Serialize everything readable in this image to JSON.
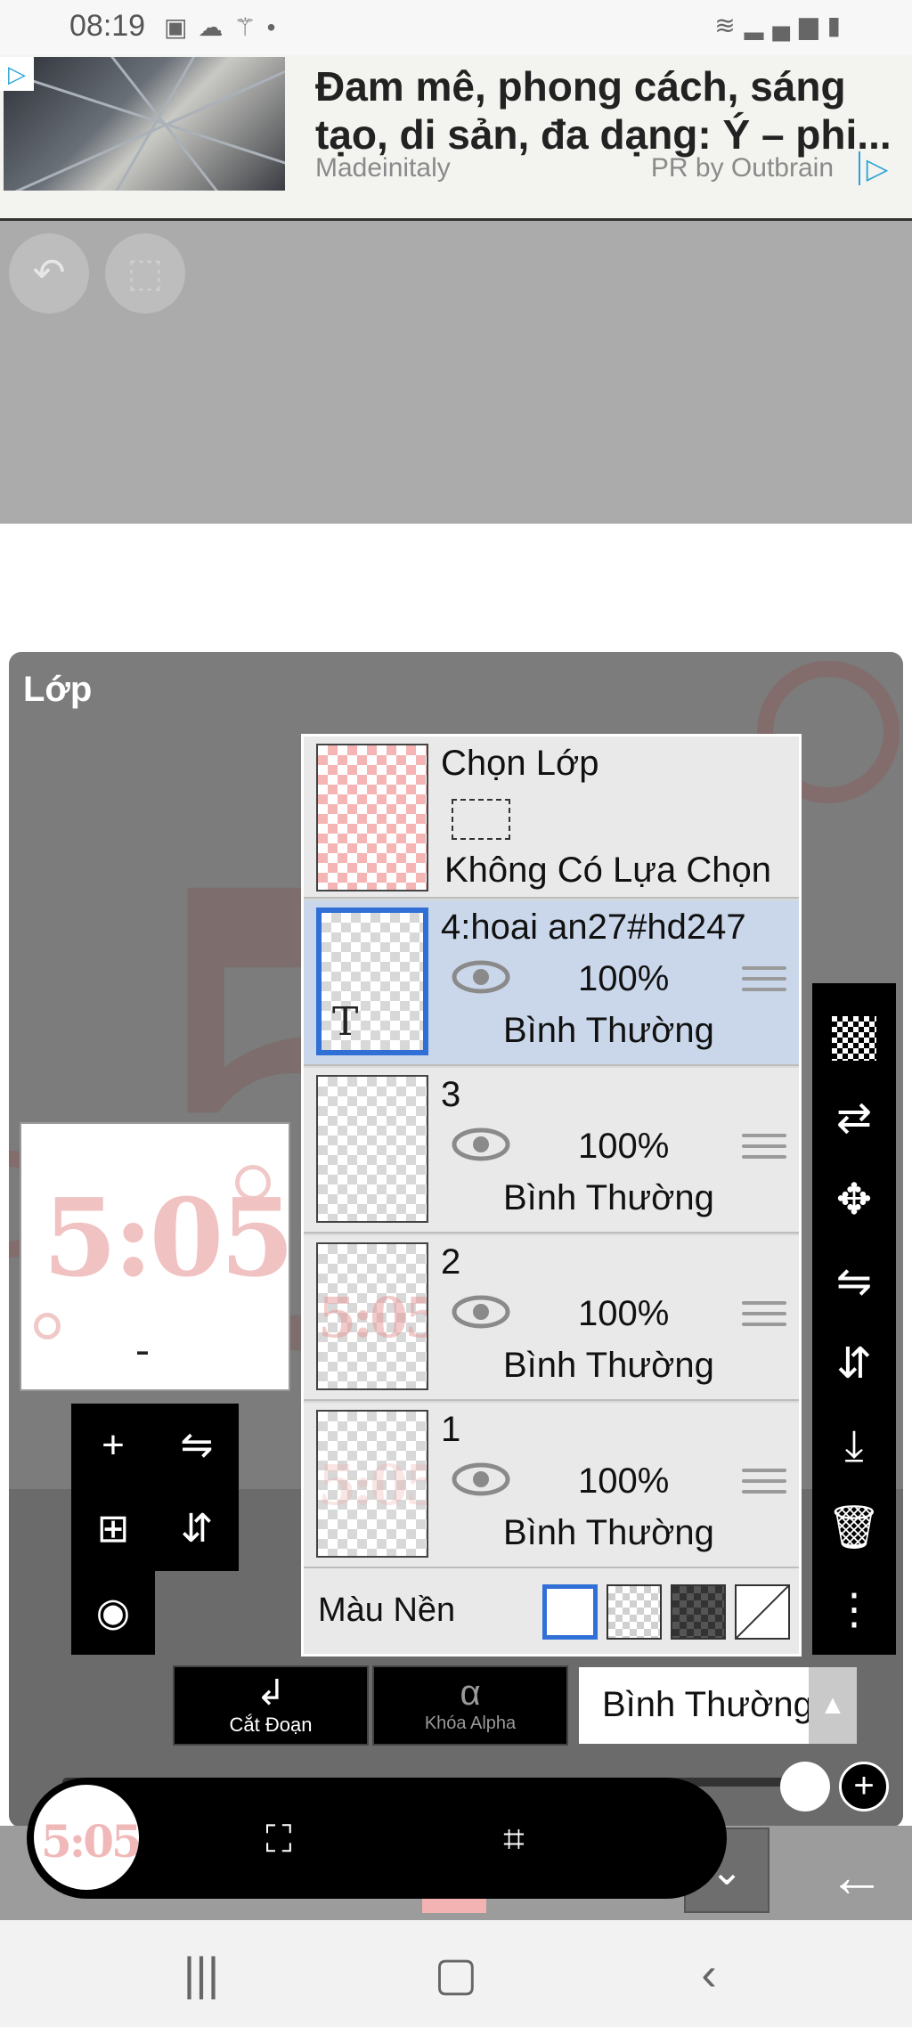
{
  "status_bar": {
    "time": "08:19",
    "left_icons": [
      "image-icon",
      "weather-icon",
      "wand-icon",
      "dot-icon"
    ],
    "right_icons": [
      "wifi-icon",
      "signal-icon",
      "battery-icon"
    ]
  },
  "ad": {
    "title": "Đam mê, phong cách, sáng tạo, di sản, đa dạng: Ý – phi...",
    "source": "Madeinitaly",
    "pr_label": "PR by Outbrain"
  },
  "top_controls": {
    "undo_icon": "undo-icon",
    "redo_icon": "redo-icon"
  },
  "layer_panel": {
    "title": "Lớp",
    "selection_row": {
      "title": "Chọn Lớp",
      "status": "Không Có Lựa Chọn"
    },
    "layers": [
      {
        "name": "4:hoai an27#hd247",
        "opacity": "100%",
        "mode": "Bình Thường",
        "selected": true,
        "type_marker": "T"
      },
      {
        "name": "3",
        "opacity": "100%",
        "mode": "Bình Thường",
        "selected": false
      },
      {
        "name": "2",
        "opacity": "100%",
        "mode": "Bình Thường",
        "selected": false,
        "thumb_text": "5:05"
      },
      {
        "name": "1",
        "opacity": "100%",
        "mode": "Bình Thường",
        "selected": false,
        "thumb_text": "5:05"
      }
    ],
    "background_label": "Màu Nền",
    "background_options": [
      "white",
      "transparent",
      "dark-checker",
      "none"
    ]
  },
  "preview": {
    "text": "5:05"
  },
  "right_tools": [
    "checker-icon",
    "transfer-icon",
    "move-icon",
    "flip-horizontal-icon",
    "flip-vertical-icon",
    "merge-down-icon",
    "trash-icon",
    "more-icon"
  ],
  "left_tools": [
    "add-layer-icon",
    "flip-h-icon",
    "add-copy-icon",
    "flip-v-icon",
    "camera-icon"
  ],
  "bottom_controls": {
    "clip_label": "Cắt Đoạn",
    "alpha_lock_label": "Khóa Alpha",
    "alpha_symbol": "α",
    "blend_mode": "Bình Thường",
    "opacity_value": 100
  },
  "floating_bar": {
    "avatar_text": "5:05"
  },
  "colors": {
    "accent_blue": "#2f6fd6",
    "selected_row": "#cad7ea",
    "panel_bg": "#7c7c7c",
    "pink": "#f5b5b5"
  }
}
